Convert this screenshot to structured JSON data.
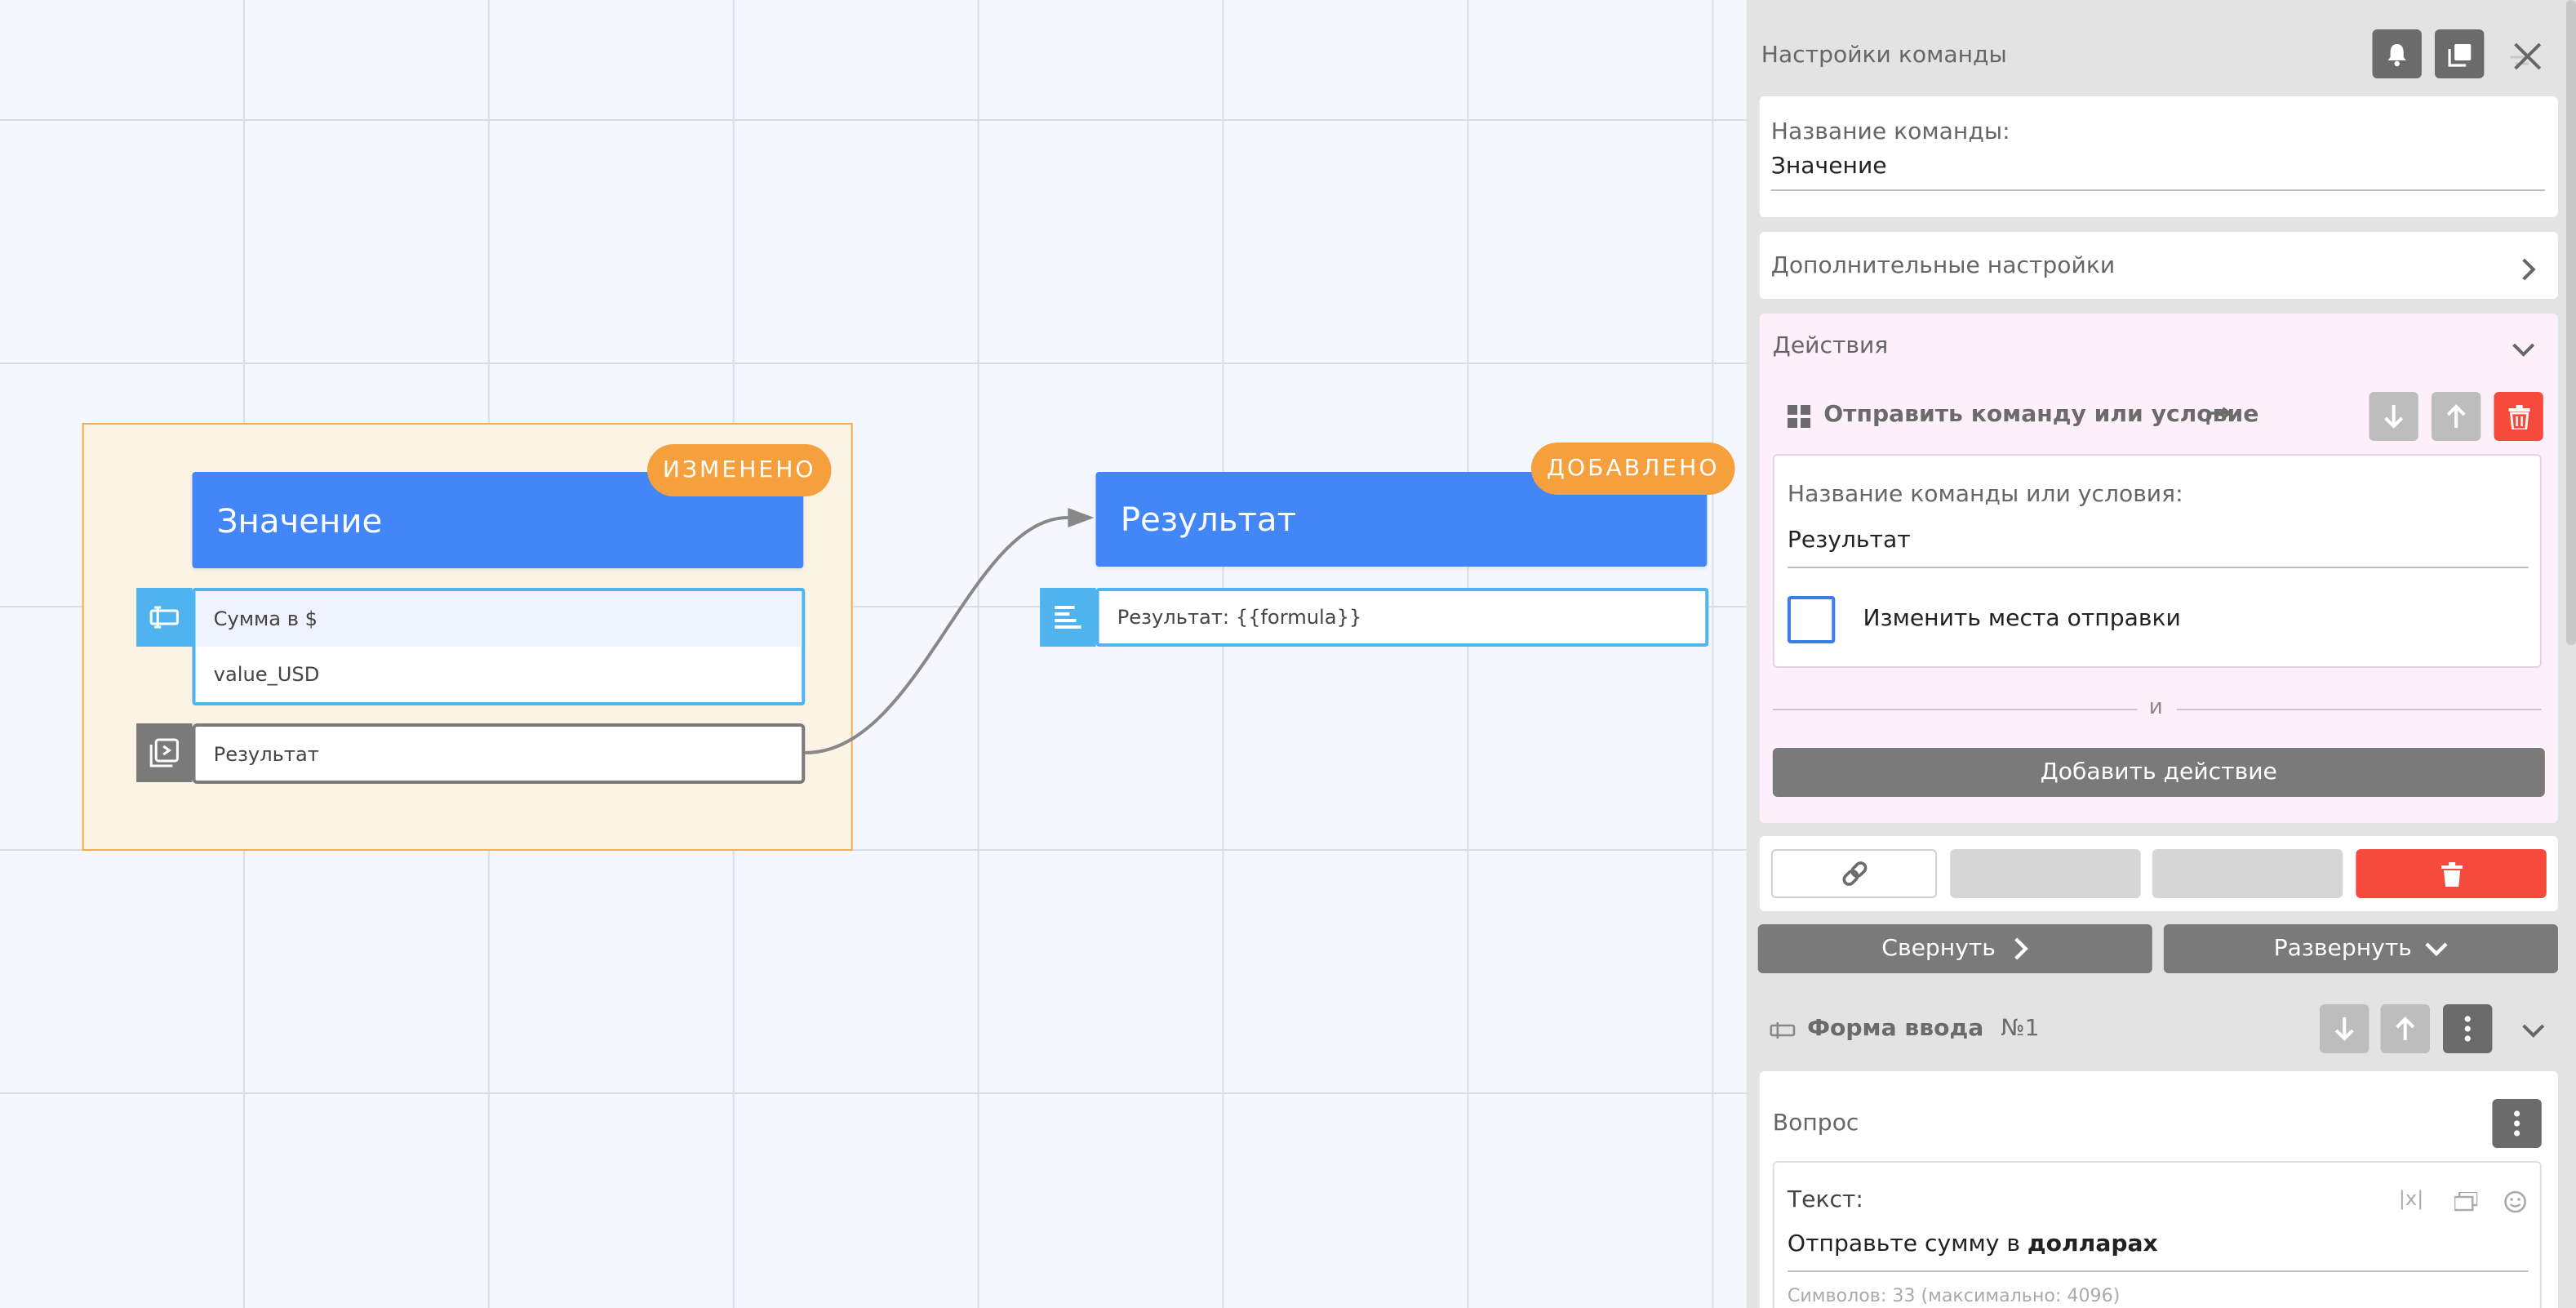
{
  "canvas": {
    "node1": {
      "title": "Значение",
      "badge": "ИЗМЕНЕНО",
      "input_label": "Сумма в $",
      "input_variable": "value_USD",
      "send_target": "Результат"
    },
    "node2": {
      "title": "Результат",
      "badge": "ДОБАВЛЕНО",
      "message_text": "Результат: {{formula}}"
    }
  },
  "panel": {
    "title": "Настройки команды",
    "command_name_label": "Название команды:",
    "command_name_value": "Значение",
    "advanced_settings": "Дополнительные настройки",
    "actions": {
      "title": "Действия",
      "action_title": "Отправить команду или условие",
      "target_label": "Название команды или условия:",
      "target_value": "Результат",
      "checkbox_label": "Изменить места отправки",
      "separator": "и",
      "add_action": "Добавить действие"
    },
    "collapse_label": "Свернуть",
    "expand_label": "Развернуть",
    "input_form": {
      "title": "Форма ввода",
      "number": "№1",
      "question_label": "Вопрос",
      "text_label": "Текст:",
      "text_value_plain": "Отправьте сумму в ",
      "text_value_bold": "долларах",
      "char_count": "Символов: 33 (максимально: 4096)"
    }
  },
  "colors": {
    "node_header": "#4286f8",
    "badge": "#f6a03d",
    "group_border": "#f6ad4e",
    "group_fill": "#fbf3e4",
    "block_blue": "#4fb3f0",
    "block_gray": "#7a7a7a",
    "danger": "#f64b3c",
    "actions_bg": "#fdf0fa"
  }
}
